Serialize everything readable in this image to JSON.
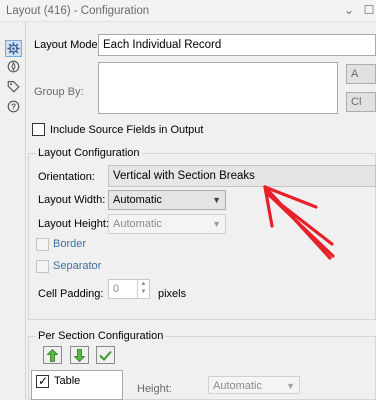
{
  "window": {
    "title": "Layout (416) - Configuration"
  },
  "sidebar": {
    "items": [
      {
        "icon": "gear-icon",
        "active": true
      },
      {
        "icon": "compass-icon",
        "active": false
      },
      {
        "icon": "tag-icon",
        "active": false
      },
      {
        "icon": "help-icon",
        "active": false
      }
    ]
  },
  "main": {
    "layout_mode_label": "Layout Mode:",
    "layout_mode_value": "Each Individual Record",
    "group_by_label": "Group By:",
    "side_buttons": [
      "A",
      "Cl"
    ],
    "include_source_label": "Include Source Fields in Output",
    "include_source_checked": false
  },
  "layout_config": {
    "title": "Layout Configuration",
    "orientation_label": "Orientation:",
    "orientation_value": "Vertical with Section Breaks",
    "layout_width_label": "Layout Width:",
    "layout_width_value": "Automatic",
    "layout_height_label": "Layout Height:",
    "layout_height_value": "Automatic",
    "border_label": "Border",
    "separator_label": "Separator",
    "cell_padding_label": "Cell Padding:",
    "cell_padding_value": "0",
    "cell_padding_unit": "pixels"
  },
  "per_section": {
    "title": "Per Section Configuration",
    "table_item": "Table",
    "table_checked": true,
    "height_label": "Height:",
    "height_value": "Automatic"
  },
  "colors": {
    "arrow_annotation": "#e8202a",
    "move_arrows": "#3a9a2e"
  }
}
